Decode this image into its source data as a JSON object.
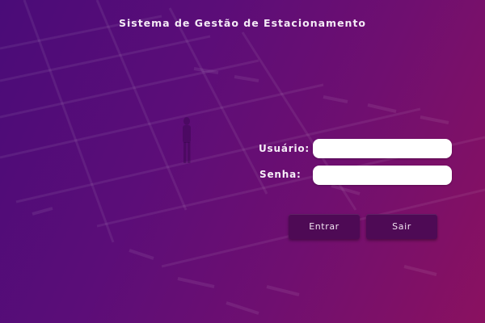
{
  "window": {
    "title": "Sistema de Gestão de Estacionamento"
  },
  "form": {
    "username_label": "Usuário:",
    "username_value": "",
    "password_label": "Senha:",
    "password_value": ""
  },
  "actions": {
    "login_label": "Entrar",
    "exit_label": "Sair"
  },
  "background": {
    "description_icon": "parking-lot-background",
    "gradient_start": "#4a0c78",
    "gradient_end": "#8a1160",
    "button_color": "#4e0a55"
  }
}
